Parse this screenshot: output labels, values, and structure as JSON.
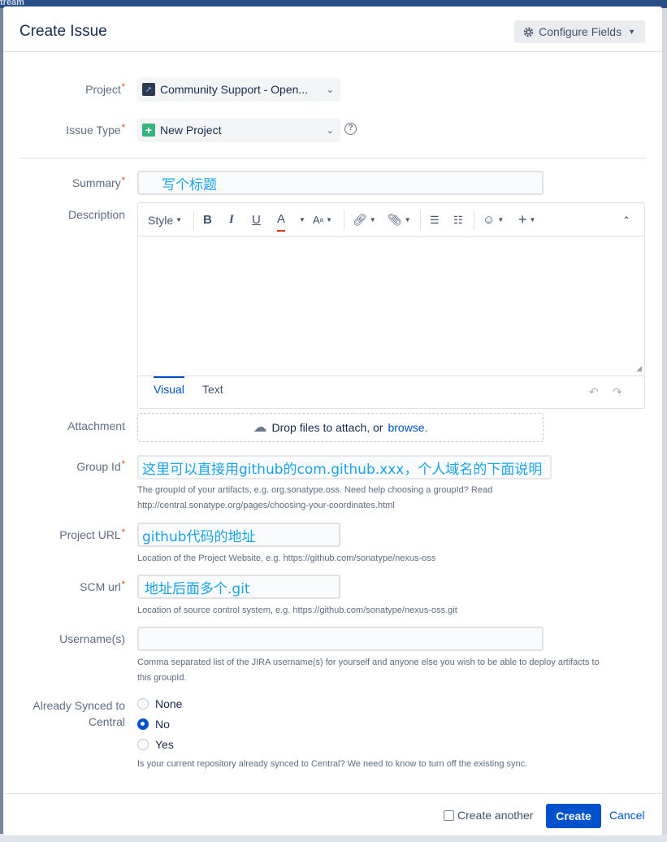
{
  "backdrop": {
    "top_text": "tream"
  },
  "dialog": {
    "title": "Create Issue",
    "configure_fields": "Configure Fields"
  },
  "fields": {
    "project": {
      "label": "Project",
      "value": "Community Support - Open..."
    },
    "issue_type": {
      "label": "Issue Type",
      "value": "New Project"
    },
    "summary": {
      "label": "Summary",
      "value": "写个标题"
    },
    "description": {
      "label": "Description"
    },
    "attachment": {
      "label": "Attachment",
      "drop_text": "Drop files to attach, or",
      "browse": "browse."
    },
    "group_id": {
      "label": "Group Id",
      "value": "这里可以直接用github的com.github.xxx，个人域名的下面说明",
      "hint_line1": "The groupId of your artifacts, e.g. org.sonatype.oss. Need help choosing a groupId? Read",
      "hint_line2": "http://central.sonatype.org/pages/choosing-your-coordinates.html"
    },
    "project_url": {
      "label": "Project URL",
      "value": "github代码的地址",
      "hint": "Location of the Project Website, e.g. https://github.com/sonatype/nexus-oss"
    },
    "scm_url": {
      "label": "SCM url",
      "value": "地址后面多个.git",
      "hint": "Location of source control system, e.g. https://github.com/sonatype/nexus-oss.git"
    },
    "usernames": {
      "label": "Username(s)",
      "value": "",
      "hint_line1": "Comma separated list of the JIRA username(s) for yourself and anyone else you wish to be able to deploy artifacts to",
      "hint_line2": "this groupId."
    },
    "already_synced": {
      "label_line1": "Already Synced to",
      "label_line2": "Central",
      "options": [
        "None",
        "No",
        "Yes"
      ],
      "selected": "No",
      "hint": "Is your current repository already synced to Central? We need to know to turn off the existing sync."
    }
  },
  "editor": {
    "style_label": "Style",
    "tabs": [
      "Visual",
      "Text"
    ]
  },
  "footer": {
    "create_another": "Create another",
    "create": "Create",
    "cancel": "Cancel"
  },
  "colors": {
    "accent": "#0052cc",
    "required": "#de350b",
    "annotation": "#1aa3e8"
  },
  "icons": [
    "gear-icon",
    "chevron-down-icon",
    "help-icon",
    "bold-icon",
    "italic-icon",
    "underline-icon",
    "text-color-icon",
    "link-icon",
    "attachment-icon",
    "bullet-list-icon",
    "numbered-list-icon",
    "emoji-icon",
    "plus-icon",
    "collapse-icon",
    "undo-icon",
    "redo-icon",
    "cloud-upload-icon"
  ]
}
